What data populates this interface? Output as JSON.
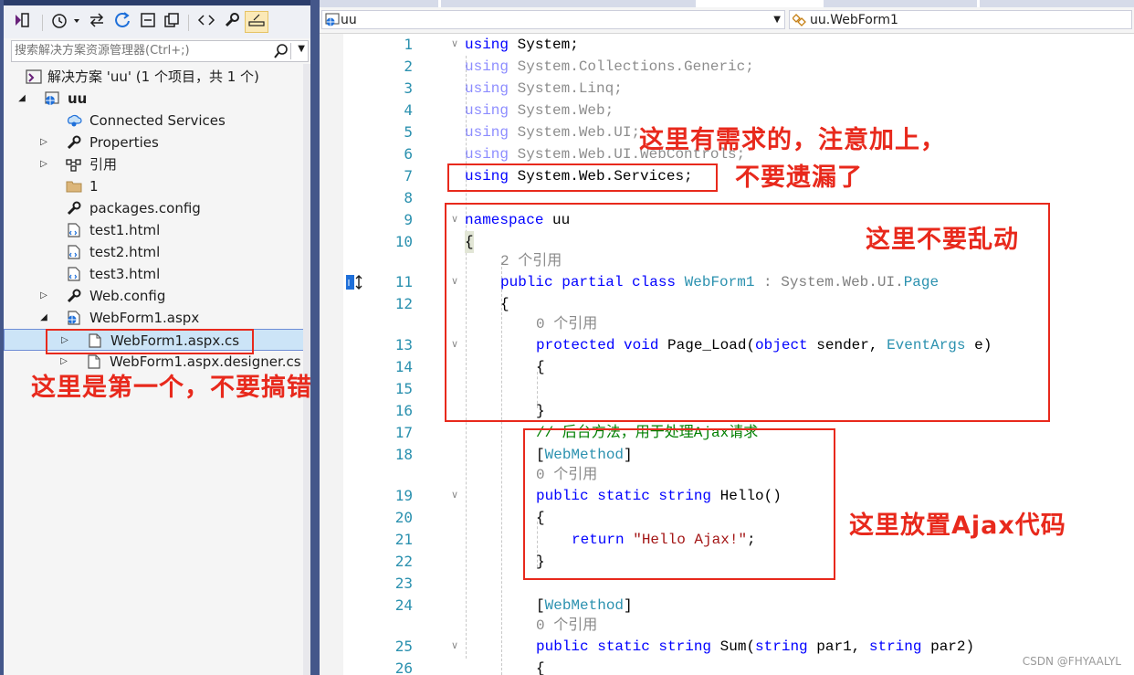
{
  "explorer": {
    "search_placeholder": "搜索解决方案资源管理器(Ctrl+;)",
    "solution_label": "解决方案 'uu' (1 个项目，共 1 个)",
    "project_label": "uu",
    "items": [
      {
        "label": "Connected Services",
        "icon": "connected-services-icon"
      },
      {
        "label": "Properties",
        "icon": "wrench-icon"
      },
      {
        "label": "引用",
        "icon": "references-icon"
      },
      {
        "label": "1",
        "icon": "folder-icon"
      },
      {
        "label": "packages.config",
        "icon": "config-file-icon"
      },
      {
        "label": "test1.html",
        "icon": "html-file-icon"
      },
      {
        "label": "test2.html",
        "icon": "html-file-icon"
      },
      {
        "label": "test3.html",
        "icon": "html-file-icon"
      },
      {
        "label": "Web.config",
        "icon": "config-file-icon"
      },
      {
        "label": "WebForm1.aspx",
        "icon": "web-form-icon"
      },
      {
        "label": "WebForm1.aspx.cs",
        "icon": "code-file-icon"
      },
      {
        "label": "WebForm1.aspx.designer.cs",
        "icon": "code-file-icon"
      }
    ]
  },
  "editor": {
    "nav_project": "uu",
    "nav_class": "uu.WebForm1",
    "line_numbers": [
      "1",
      "2",
      "3",
      "4",
      "5",
      "6",
      "7",
      "8",
      "9",
      "10",
      "11",
      "12",
      "13",
      "14",
      "15",
      "16",
      "17",
      "18",
      "19",
      "20",
      "21",
      "22",
      "23",
      "24",
      "25",
      "26"
    ],
    "hints": {
      "refs_2": "2 个引用",
      "refs_0_a": "0 个引用",
      "refs_0_b": "0 个引用",
      "refs_0_c": "0 个引用"
    },
    "code": {
      "l1_kw": "using",
      "l1_rest": " System;",
      "l2_kw": "using",
      "l2_rest": " System.Collections.Generic;",
      "l3_kw": "using",
      "l3_rest": " System.Linq;",
      "l4_kw": "using",
      "l4_rest": " System.Web;",
      "l5_kw": "using",
      "l5_rest": " System.Web.UI;",
      "l6_kw": "using",
      "l6_rest": " System.Web.UI.WebControls;",
      "l7_kw": "using",
      "l7_rest": " System.Web.Services;",
      "l9_kw": "namespace",
      "l9_rest": " uu",
      "l10": "{",
      "l11_kw": "public partial class",
      "l11_type": "WebForm1",
      "l11_colon": " : ",
      "l11_base": "System.Web.UI.",
      "l11_page": "Page",
      "l12": "{",
      "l13_kw": "protected void",
      "l13_name": " Page_Load(",
      "l13_obj": "object",
      "l13_sender": " sender, ",
      "l13_ea": "EventArgs",
      "l13_end": " e)",
      "l14": "{",
      "l16": "}",
      "l17_comment": "// 后台方法，用于处理Ajax请求",
      "l18_open": "[",
      "l18_attr": "WebMethod",
      "l18_close": "]",
      "l19_kw": "public static string",
      "l19_rest": " Hello()",
      "l20": "{",
      "l21_kw": "return",
      "l21_str": "\"Hello Ajax!\"",
      "l21_end": ";",
      "l22": "}",
      "l24_open": "[",
      "l24_attr": "WebMethod",
      "l24_close": "]",
      "l25_kw": "public static string",
      "l25_rest": " Sum(",
      "l25_str1": "string",
      "l25_p1": " par1, ",
      "l25_str2": "string",
      "l25_p2": " par2)",
      "l26": "{"
    }
  },
  "annotations": {
    "using_note_1": "这里有需求的，注意加上，",
    "using_note_2": "不要遗漏了",
    "namespace_note": "这里不要乱动",
    "ajax_note": "这里放置Ajax代码",
    "file_note": "这里是第一个，不要搞错了",
    "color": "#e8291c"
  },
  "watermark": "CSDN @FHYAALYL"
}
